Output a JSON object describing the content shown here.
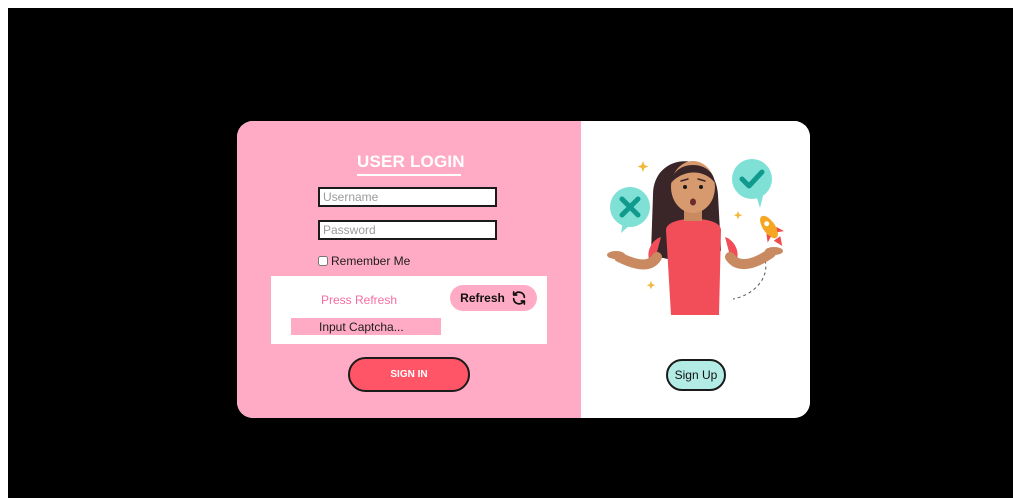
{
  "login": {
    "title": "USER LOGIN",
    "username_placeholder": "Username",
    "password_placeholder": "Password",
    "remember_label": "Remember Me",
    "captcha_text": "Press Refresh",
    "refresh_label": "Refresh",
    "captcha_input_placeholder": "Input Captcha...",
    "signin_label": "SIGN IN"
  },
  "signup": {
    "label": "Sign Up"
  },
  "colors": {
    "left_panel": "#ffabc6",
    "signin_button": "#ff5566",
    "signup_button": "#b2ece4",
    "captcha_text": "#f56da3",
    "page_background": "#000000"
  },
  "icons": {
    "refresh": "refresh-icon",
    "illustration": "girl-choice-illustration"
  }
}
